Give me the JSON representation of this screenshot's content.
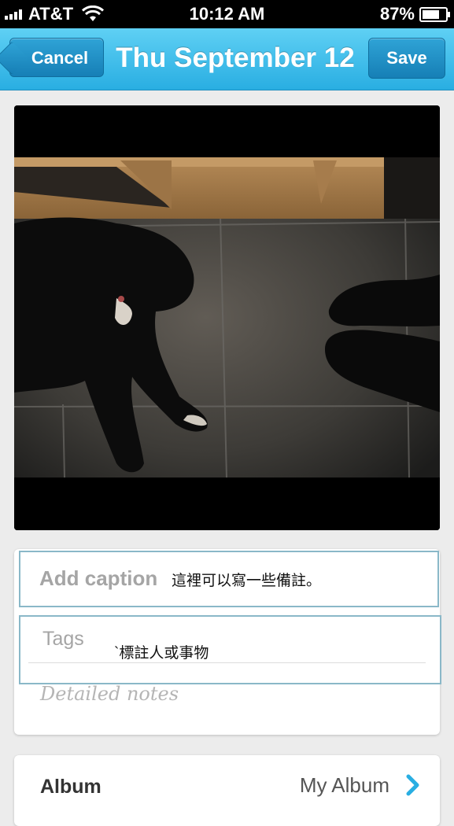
{
  "status_bar": {
    "carrier": "AT&T",
    "time": "10:12 AM",
    "battery": "87%",
    "battery_level": 0.87,
    "signal_bars": 4
  },
  "nav": {
    "cancel_label": "Cancel",
    "title": "Thu September 12",
    "save_label": "Save"
  },
  "form": {
    "caption_placeholder": "Add caption",
    "caption_value": "這裡可以寫一些備註。",
    "tags_placeholder": "Tags",
    "tags_value": "`標註人或事物",
    "notes_placeholder": "Detailed notes"
  },
  "album": {
    "label": "Album",
    "value": "My Album"
  },
  "colors": {
    "nav_top": "#5fd0f4",
    "nav_bottom": "#29aee2",
    "button": "#167fb6",
    "field_border": "#8ab8c8",
    "chevron": "#29aee2"
  }
}
